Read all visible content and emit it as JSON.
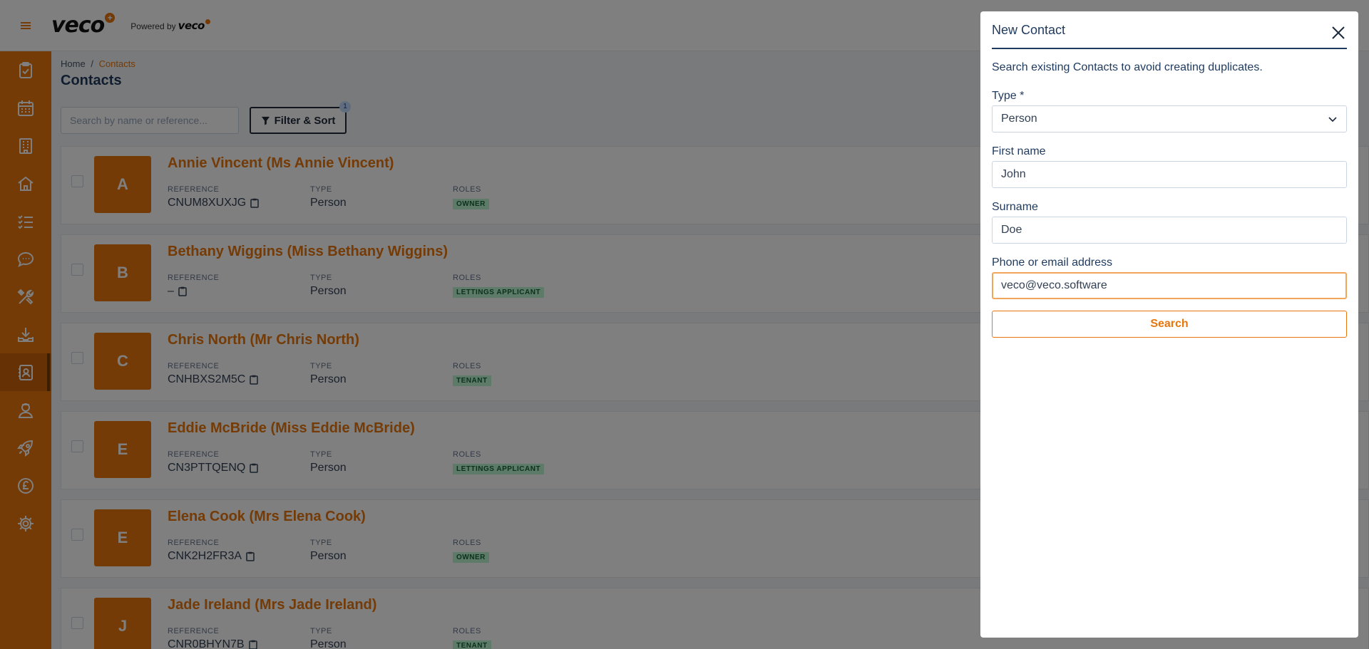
{
  "header": {
    "logo_text": "veco",
    "logo_plus": "+",
    "powered_by": "Powered by",
    "powered_brand": "veco"
  },
  "sidebar": {
    "items": [
      {
        "icon": "clipboard-check-icon"
      },
      {
        "icon": "calendar-icon"
      },
      {
        "icon": "building-icon"
      },
      {
        "icon": "house-icon"
      },
      {
        "icon": "task-list-icon"
      },
      {
        "icon": "chat-bubble-icon"
      },
      {
        "icon": "tools-icon"
      },
      {
        "icon": "inbox-download-icon"
      },
      {
        "icon": "contacts-icon",
        "active": true
      },
      {
        "icon": "user-badge-icon"
      },
      {
        "icon": "rocket-icon"
      },
      {
        "icon": "pound-coin-icon"
      },
      {
        "icon": "gear-icon"
      }
    ]
  },
  "breadcrumb": {
    "home": "Home",
    "separator": "/",
    "current": "Contacts"
  },
  "page_title": "Contacts",
  "search": {
    "placeholder": "Search by name or reference..."
  },
  "filter": {
    "label": "Filter & Sort",
    "badge": "1"
  },
  "labels": {
    "reference": "REFERENCE",
    "type": "TYPE",
    "roles": "ROLES"
  },
  "contacts": [
    {
      "initial": "A",
      "name": "Annie Vincent (Ms Annie Vincent)",
      "reference": "CNUM8XUXJG",
      "type": "Person",
      "role": "OWNER"
    },
    {
      "initial": "B",
      "name": "Bethany Wiggins (Miss Bethany Wiggins)",
      "reference": "–",
      "type": "Person",
      "role": "LETTINGS APPLICANT"
    },
    {
      "initial": "C",
      "name": "Chris North (Mr Chris North)",
      "reference": "CNHBXS2M5C",
      "type": "Person",
      "role": "TENANT"
    },
    {
      "initial": "E",
      "name": "Eddie McBride (Miss Eddie McBride)",
      "reference": "CN3PTTQENQ",
      "type": "Person",
      "role": "LETTINGS APPLICANT"
    },
    {
      "initial": "E",
      "name": "Elena Cook (Mrs Elena Cook)",
      "reference": "CNK2H2FR3A",
      "type": "Person",
      "role": "OWNER"
    },
    {
      "initial": "J",
      "name": "Jade Ireland (Mrs Jade Ireland)",
      "reference": "CNR0BHYN7B",
      "type": "Person",
      "role": "TENANT"
    }
  ],
  "drawer": {
    "title": "New Contact",
    "hint": "Search existing Contacts to avoid creating duplicates.",
    "type_label": "Type *",
    "type_value": "Person",
    "first_name_label": "First name",
    "first_name_value": "John",
    "surname_label": "Surname",
    "surname_value": "Doe",
    "contact_label": "Phone or email address",
    "contact_value": "veco@veco.software",
    "search_button": "Search"
  }
}
